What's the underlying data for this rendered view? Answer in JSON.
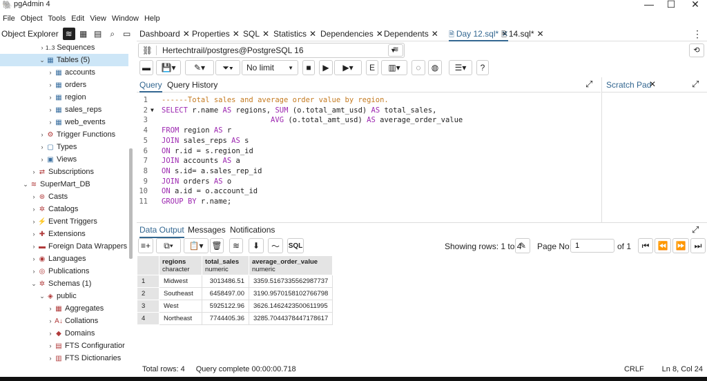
{
  "app": {
    "title": "pgAdmin 4"
  },
  "menu": [
    "File",
    "Object",
    "Tools",
    "Edit",
    "View",
    "Window",
    "Help"
  ],
  "object_explorer": {
    "title": "Object Explorer",
    "tree": [
      {
        "label": "Sequences",
        "prefix": "1..3",
        "indent": 1,
        "icon": "sequence-icon",
        "glyph": "",
        "expanded": false
      },
      {
        "label": "Tables (5)",
        "indent": 1,
        "icon": "table-icon",
        "glyph": "▦",
        "expanded": true,
        "selected": true
      },
      {
        "label": "accounts",
        "indent": 2,
        "icon": "table-icon",
        "glyph": "▦",
        "expanded": false
      },
      {
        "label": "orders",
        "indent": 2,
        "icon": "table-icon",
        "glyph": "▦",
        "expanded": false
      },
      {
        "label": "region",
        "indent": 2,
        "icon": "table-icon",
        "glyph": "▦",
        "expanded": false
      },
      {
        "label": "sales_reps",
        "indent": 2,
        "icon": "table-icon",
        "glyph": "▦",
        "expanded": false
      },
      {
        "label": "web_events",
        "indent": 2,
        "icon": "table-icon",
        "glyph": "▦",
        "expanded": false
      },
      {
        "label": "Trigger Functions",
        "indent": 1,
        "icon": "trigger-function-icon",
        "glyph": "⚙",
        "expanded": false
      },
      {
        "label": "Types",
        "indent": 1,
        "icon": "types-icon",
        "glyph": "▢",
        "expanded": false
      },
      {
        "label": "Views",
        "indent": 1,
        "icon": "views-icon",
        "glyph": "▣",
        "expanded": false
      },
      {
        "label": "Subscriptions",
        "indent": 0,
        "icon": "subscriptions-icon",
        "glyph": "⇄",
        "expanded": false
      },
      {
        "label": "SuperMart_DB",
        "indent": -1,
        "icon": "database-icon",
        "glyph": "≋",
        "expanded": true
      },
      {
        "label": "Casts",
        "indent": 0,
        "icon": "casts-icon",
        "glyph": "⊛",
        "expanded": false
      },
      {
        "label": "Catalogs",
        "indent": 0,
        "icon": "catalogs-icon",
        "glyph": "✲",
        "expanded": false
      },
      {
        "label": "Event Triggers",
        "indent": 0,
        "icon": "event-triggers-icon",
        "glyph": "⚡",
        "expanded": false
      },
      {
        "label": "Extensions",
        "indent": 0,
        "icon": "extensions-icon",
        "glyph": "✚",
        "expanded": false
      },
      {
        "label": "Foreign Data Wrappers",
        "indent": 0,
        "icon": "fdw-icon",
        "glyph": "▬",
        "expanded": false
      },
      {
        "label": "Languages",
        "indent": 0,
        "icon": "languages-icon",
        "glyph": "◉",
        "expanded": false
      },
      {
        "label": "Publications",
        "indent": 0,
        "icon": "publications-icon",
        "glyph": "◎",
        "expanded": false
      },
      {
        "label": "Schemas (1)",
        "indent": 0,
        "icon": "schemas-icon",
        "glyph": "✲",
        "expanded": true
      },
      {
        "label": "public",
        "indent": 1,
        "icon": "schema-icon",
        "glyph": "◈",
        "expanded": true
      },
      {
        "label": "Aggregates",
        "indent": 2,
        "icon": "aggregates-icon",
        "glyph": "▦",
        "expanded": false
      },
      {
        "label": "Collations",
        "indent": 2,
        "icon": "collations-icon",
        "glyph": "A↓",
        "expanded": false
      },
      {
        "label": "Domains",
        "indent": 2,
        "icon": "domains-icon",
        "glyph": "◆",
        "expanded": false
      },
      {
        "label": "FTS Configuratior",
        "indent": 2,
        "icon": "fts-config-icon",
        "glyph": "▤",
        "expanded": false
      },
      {
        "label": "FTS Dictionaries",
        "indent": 2,
        "icon": "fts-dict-icon",
        "glyph": "▥",
        "expanded": false
      }
    ]
  },
  "tabs": [
    {
      "label": "Dashboard",
      "active": false
    },
    {
      "label": "Properties",
      "active": false
    },
    {
      "label": "SQL",
      "active": false
    },
    {
      "label": "Statistics",
      "active": false
    },
    {
      "label": "Dependencies",
      "active": false
    },
    {
      "label": "Dependents",
      "active": false
    },
    {
      "label": "Day 12.sql*",
      "active": true
    },
    {
      "label": "14.sql*",
      "active": false
    }
  ],
  "connection": {
    "value": "Hertechtrail/postgres@PostgreSQL 16"
  },
  "toolbar": {
    "limit_label": "No limit"
  },
  "query_tabs": {
    "query": "Query",
    "history": "Query History"
  },
  "scratch_pad": {
    "title": "Scratch Pad"
  },
  "editor": {
    "lines": [
      {
        "n": "1",
        "text": "------Total sales and average order value by region."
      },
      {
        "n": "2",
        "text": "SELECT r.name AS regions, SUM (o.total_amt_usd) AS total_sales,"
      },
      {
        "n": "3",
        "text": "                         AVG (o.total_amt_usd) AS average_order_value"
      },
      {
        "n": "4",
        "text": "FROM region AS r"
      },
      {
        "n": "5",
        "text": "JOIN sales_reps AS s"
      },
      {
        "n": "6",
        "text": "ON r.id = s.region_id"
      },
      {
        "n": "7",
        "text": "JOIN accounts AS a"
      },
      {
        "n": "8",
        "text": "ON s.id= a.sales_rep_id"
      },
      {
        "n": "9",
        "text": "JOIN orders AS o"
      },
      {
        "n": "10",
        "text": "ON a.id = o.account_id"
      },
      {
        "n": "11",
        "text": "GROUP BY r.name;"
      }
    ]
  },
  "output_tabs": {
    "data_output": "Data Output",
    "messages": "Messages",
    "notifications": "Notifications"
  },
  "output_toolbar": {
    "sql_label": "SQL",
    "showing": "Showing rows: 1 to 4",
    "page_label": "Page No:",
    "page_value": "1",
    "of_label": "of 1"
  },
  "grid": {
    "columns": [
      {
        "name": "regions",
        "type": "character"
      },
      {
        "name": "total_sales",
        "type": "numeric"
      },
      {
        "name": "average_order_value",
        "type": "numeric"
      }
    ],
    "rows": [
      [
        "1",
        "Midwest",
        "3013486.51",
        "3359.5167335562987737"
      ],
      [
        "2",
        "Southeast",
        "6458497.00",
        "3190.9570158102766798"
      ],
      [
        "3",
        "West",
        "5925122.96",
        "3626.1462423500611995"
      ],
      [
        "4",
        "Northeast",
        "7744405.36",
        "3285.7044378447178617"
      ]
    ]
  },
  "status": {
    "total_rows": "Total rows: 4",
    "query": "Query complete 00:00:00.718",
    "eol": "CRLF",
    "pos": "Ln 8, Col 24"
  }
}
